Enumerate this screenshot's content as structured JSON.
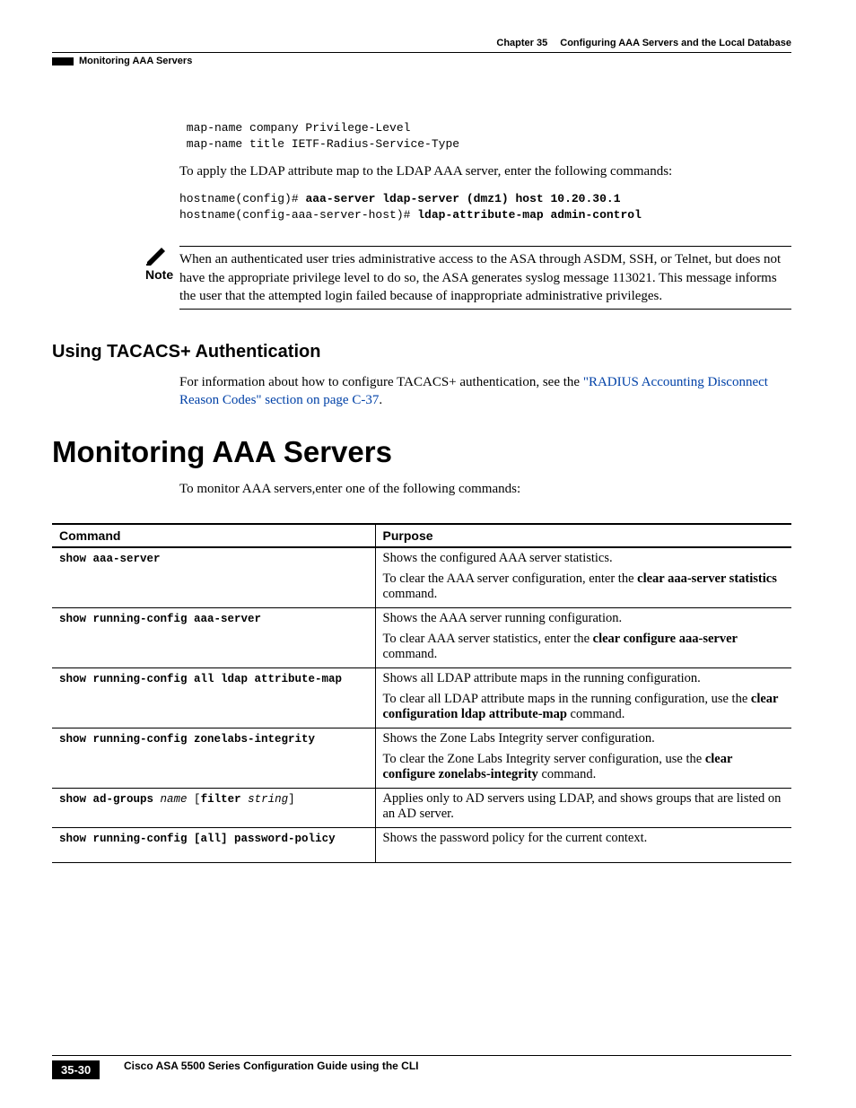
{
  "header": {
    "chapter": "Chapter 35",
    "chapter_title": "Configuring AAA Servers and the Local Database",
    "section": "Monitoring AAA Servers"
  },
  "code1": " map-name company Privilege-Level\n map-name title IETF-Radius-Service-Type",
  "p_apply": "To apply the LDAP attribute map to the LDAP AAA server, enter the following commands:",
  "code2_a": "hostname(config)# ",
  "code2_b": "aaa-server ldap-server (dmz1) host 10.20.30.1",
  "code2_c": "hostname(config-aaa-server-host)# ",
  "code2_d": "ldap-attribute-map admin-control",
  "note_label": "Note",
  "note_text": "When an authenticated user tries administrative access to the ASA through ASDM, SSH, or Telnet, but does not have the appropriate privilege level to do so, the ASA generates syslog message 113021. This message informs the user that the attempted login failed because of inappropriate administrative privileges.",
  "h3": "Using TACACS+ Authentication",
  "p_tacacs_a": "For information about how to configure TACACS+ authentication, see the ",
  "p_tacacs_link": "\"RADIUS Accounting Disconnect Reason Codes\" section on page C-37",
  "p_tacacs_b": ".",
  "h2": "Monitoring AAA Servers",
  "p_monitor": "To monitor AAA servers,enter one of the following commands:",
  "table": {
    "h1": "Command",
    "h2": "Purpose",
    "rows": [
      {
        "cmd": "show aaa-server",
        "p1": "Shows the configured AAA server statistics.",
        "p2a": "To clear the AAA server configuration, enter the ",
        "p2b": "clear aaa-server statistics",
        "p2c": " command."
      },
      {
        "cmd": "show running-config aaa-server",
        "p1": "Shows the AAA server running configuration.",
        "p2a": "To clear AAA server statistics, enter the ",
        "p2b": "clear configure aaa-server",
        "p2c": " command."
      },
      {
        "cmd": "show running-config all ldap attribute-map",
        "p1": "Shows all LDAP attribute maps in the running configuration.",
        "p2a": "To clear all LDAP attribute maps in the running configuration, use the ",
        "p2b": "clear configuration ldap attribute-map",
        "p2c": " command."
      },
      {
        "cmd": "show running-config zonelabs-integrity",
        "p1": "Shows the Zone Labs Integrity server configuration.",
        "p2a": "To clear the Zone Labs Integrity server configuration, use the ",
        "p2b": "clear configure zonelabs-integrity",
        "p2c": " command."
      },
      {
        "cmd_parts": [
          "show ad-groups ",
          "name",
          " [",
          "filter ",
          "string",
          "]"
        ],
        "p1": "Applies only to AD servers using LDAP, and shows groups that are listed on an AD server."
      },
      {
        "cmd_parts2": [
          "show running-config ",
          "[all]",
          " password-policy"
        ],
        "p1": "Shows the password policy for the current context."
      }
    ]
  },
  "footer": {
    "title": "Cisco ASA 5500 Series Configuration Guide using the CLI",
    "page": "35-30"
  }
}
